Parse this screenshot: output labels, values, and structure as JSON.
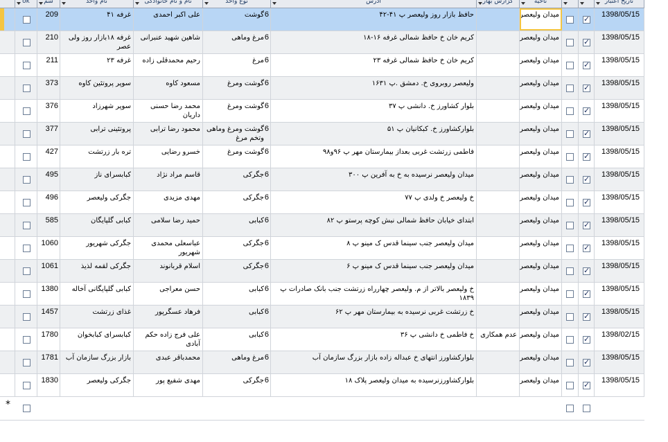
{
  "headers": {
    "ok": "ok",
    "shomare": "شم",
    "nam_vahed": "نام واحد",
    "nam_khanevadegi": "نام و نام خانوادگی",
    "no_vahed": "نوع واحد",
    "adres": "آدرس",
    "gozaresh": "گزارش بهار",
    "nahie": "ناحیه",
    "tarikh": "تاریخ اعتبار"
  },
  "new_row_marker": "*",
  "rows": [
    {
      "id": "209",
      "name": "غرفه ۴۱",
      "owner": "علی اکبر احمدی",
      "type": "گوشت",
      "type_num": "6",
      "address": "حافظ بازار روز ولیعصر پ ۴۱-۴۲",
      "report": "",
      "area": "میدان ولیعصر",
      "active": true,
      "ok": false,
      "date": "1398/05/15"
    },
    {
      "id": "210",
      "name": "غرفه ۱۸بازار روز ولی عصر",
      "owner": "شاهین شهید عنبرانی",
      "type": "مرغ وماهی",
      "type_num": "6",
      "address": "کریم خان  خ حافظ شمالی غرفه ۱۶-۱۸",
      "report": "",
      "area": "میدان ولیعصر",
      "active": true,
      "ok": false,
      "date": "1398/05/15"
    },
    {
      "id": "211",
      "name": "غرفه ۲۳",
      "owner": "رحیم محمدقلی زاده",
      "type": "مرغ",
      "type_num": "6",
      "address": "کریم خان  خ حافظ شمالی غرفه ۲۳",
      "report": "",
      "area": "میدان ولیعصر",
      "active": true,
      "ok": false,
      "date": "1398/05/15"
    },
    {
      "id": "373",
      "name": "سوپر پروتئین کاوه",
      "owner": "مسعود کاوه",
      "type": "گوشت ومرغ",
      "type_num": "6",
      "address": "ولیعصر روبروی خ. دمشق .پ ۱۶۳۱",
      "report": "",
      "area": "میدان ولیعصر",
      "active": true,
      "ok": false,
      "date": "1398/05/15"
    },
    {
      "id": "376",
      "name": "سوپر شهرزاد",
      "owner": "محمد رضا حسنی داریان",
      "type": "گوشت ومرغ",
      "type_num": "6",
      "address": "بلوار کشاورز خ. دانشی پ ۳۷",
      "report": "",
      "area": "میدان ولیعصر",
      "active": true,
      "ok": false,
      "date": "1398/05/15"
    },
    {
      "id": "377",
      "name": "پروتئینی ترابی",
      "owner": "محمود رضا ترابی",
      "type": "گوشت ومرغ وماهی وتخم مرغ",
      "type_num": "6",
      "address": "بلوارکشاورز خ. کبکانیان پ ۵۱",
      "report": "",
      "area": "میدان ولیعصر",
      "active": true,
      "ok": false,
      "date": "1398/05/15"
    },
    {
      "id": "427",
      "name": "تره بار زرتشت",
      "owner": "خسرو رضایی",
      "type": "گوشت ومرغ",
      "type_num": "6",
      "address": "فاطمی زرتشت غربی بعداز بیمارستان مهر پ ۹۶و۹۸",
      "report": "",
      "area": "میدان ولیعصر",
      "active": true,
      "ok": false,
      "date": "1398/05/15"
    },
    {
      "id": "495",
      "name": "کبابسرای ناز",
      "owner": "قاسم مراد نژاد",
      "type": "جگرکی",
      "type_num": "6",
      "address": "میدان ولیعصر نرسیده به خ به آفرین پ ۳۰۰",
      "report": "",
      "area": "میدان ولیعصر",
      "active": true,
      "ok": false,
      "date": "1398/05/15"
    },
    {
      "id": "496",
      "name": "جگرکی ولیعصر",
      "owner": "مهدی مزیدی",
      "type": "جگرکی",
      "type_num": "6",
      "address": "خ ولیعصر خ ولدی پ ۷۷",
      "report": "",
      "area": "میدان ولیعصر",
      "active": true,
      "ok": false,
      "date": "1398/05/15"
    },
    {
      "id": "585",
      "name": "کبابی گلپایگان",
      "owner": "حمید رضا سلامی",
      "type": "کبابی",
      "type_num": "6",
      "address": "ابتدای خیابان حافظ شمالی نبش کوچه پرستو پ ۸۲",
      "report": "",
      "area": "میدان ولیعصر",
      "active": true,
      "ok": false,
      "date": "1398/05/15"
    },
    {
      "id": "1060",
      "name": "جگرکی شهریور",
      "owner": "عباسعلی محمدی شهریور",
      "type": "جگرکی",
      "type_num": "6",
      "address": "میدان ولیعصر جنب سینما قدس ک مینو پ ۸",
      "report": "",
      "area": "میدان ولیعصر",
      "active": true,
      "ok": false,
      "date": "1398/05/15"
    },
    {
      "id": "1061",
      "name": "جگرکی لقمه لذیذ",
      "owner": "اسلام قربانوند",
      "type": "جگرکی",
      "type_num": "6",
      "address": "میدان ولیعصر جنب سینما قدس ک مینو پ ۶",
      "report": "",
      "area": "میدان ولیعصر",
      "active": true,
      "ok": false,
      "date": "1398/05/15"
    },
    {
      "id": "1380",
      "name": "کبابی گلپایگانی آخاله",
      "owner": "حسن معراجی",
      "type": "کبابی",
      "type_num": "6",
      "address": "خ ولیعصر بالاتر از م. ولیعصر چهارراه زرتشت جنب بانک صادرات پ ۱۸۳۹",
      "report": "",
      "area": "میدان ولیعصر",
      "active": true,
      "ok": false,
      "date": "1398/05/15"
    },
    {
      "id": "1457",
      "name": "غذای زرتشت",
      "owner": "فرهاد عسگرپور",
      "type": "کبابی",
      "type_num": "6",
      "address": "خ زرتشت غربی نرسیده به بیمارستان مهر پ ۶۲",
      "report": "",
      "area": "میدان ولیعصر",
      "active": true,
      "ok": false,
      "date": "1398/05/15"
    },
    {
      "id": "1780",
      "name": "کبابسرای کبابخوان",
      "owner": "علی فرج زاده حکم آبادی",
      "type": "کبابی",
      "type_num": "6",
      "address": "خ فاطمی خ دانشی پ ۳۶",
      "report": "عدم همکاری",
      "area": "میدان ولیعصر",
      "active": true,
      "ok": false,
      "date": "1398/02/15"
    },
    {
      "id": "1781",
      "name": "بازار بزرگ سازمان آب",
      "owner": "محمدباقر عبدی",
      "type": "مرغ وماهی",
      "type_num": "6",
      "address": "بلوارکشاورز انتهای خ عبداله زاده بازار بزرگ سازمان آب",
      "report": "",
      "area": "میدان ولیعصر",
      "active": true,
      "ok": false,
      "date": "1398/05/15"
    },
    {
      "id": "1830",
      "name": "جگرکی ولیعصر",
      "owner": "مهدی شفیع پور",
      "type": "جگرکی",
      "type_num": "6",
      "address": "بلوارکشاورزنرسیده به میدان ولیعصر پلاک ۱۸",
      "report": "",
      "area": "میدان ولیعصر",
      "active": true,
      "ok": false,
      "date": "1398/05/15"
    }
  ]
}
